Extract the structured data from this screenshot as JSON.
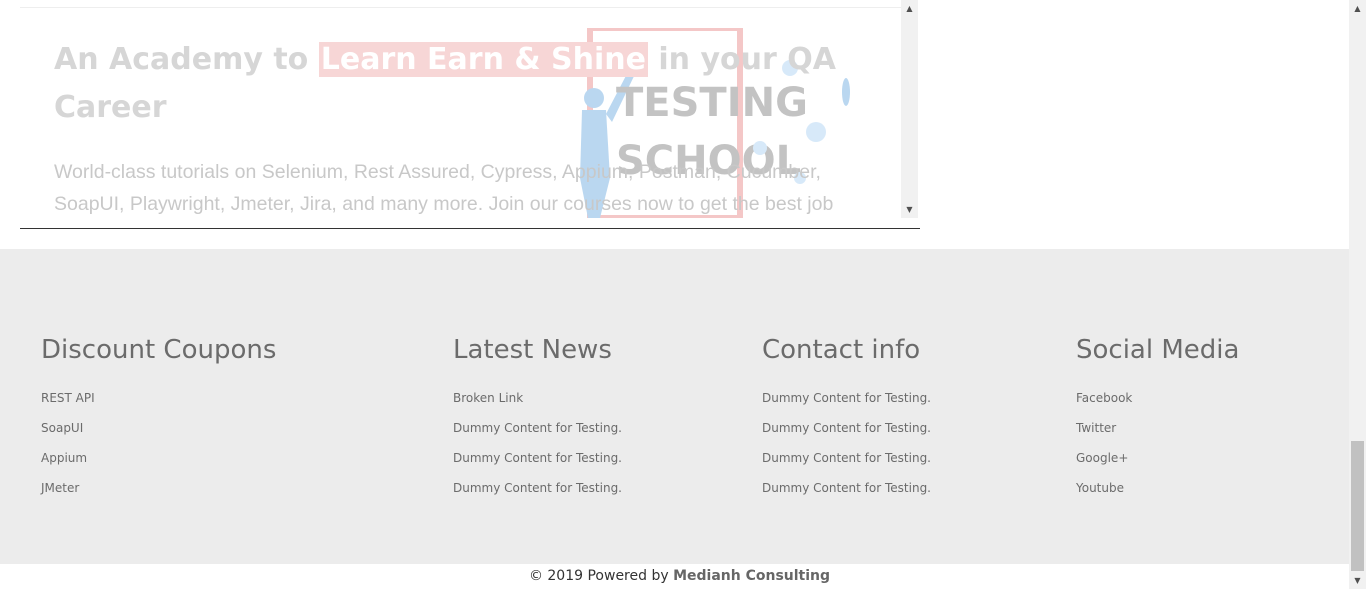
{
  "hero": {
    "title_before": "An Academy to ",
    "title_highlight": "Learn Earn & Shine",
    "title_after": "  in your QA Career",
    "description": "World-class tutorials on Selenium, Rest Assured, Cypress, Appium, Postman, Cucumber, SoapUI, Playwright, Jmeter, Jira, and many more. Join our courses now to get the best job",
    "logo_line1": "TESTING",
    "logo_line2": "SCHOOL"
  },
  "footer": {
    "columns": [
      {
        "heading": "Discount Coupons",
        "items": [
          "REST API",
          "SoapUI",
          "Appium",
          "JMeter"
        ]
      },
      {
        "heading": "Latest News",
        "items": [
          "Broken Link",
          "Dummy Content for Testing.",
          "Dummy Content for Testing.",
          "Dummy Content for Testing."
        ]
      },
      {
        "heading": "Contact info",
        "items": [
          "Dummy Content for Testing.",
          "Dummy Content for Testing.",
          "Dummy Content for Testing.",
          "Dummy Content for Testing."
        ]
      },
      {
        "heading": "Social Media",
        "items": [
          "Facebook",
          "Twitter",
          "Google+",
          "Youtube"
        ]
      }
    ],
    "copyright_prefix": "© 2019 Powered by ",
    "copyright_brand": "Medianh Consulting"
  },
  "icons": {
    "scroll_up": "scroll-up-icon",
    "scroll_down": "scroll-down-icon",
    "logo": "testing-school-logo"
  }
}
